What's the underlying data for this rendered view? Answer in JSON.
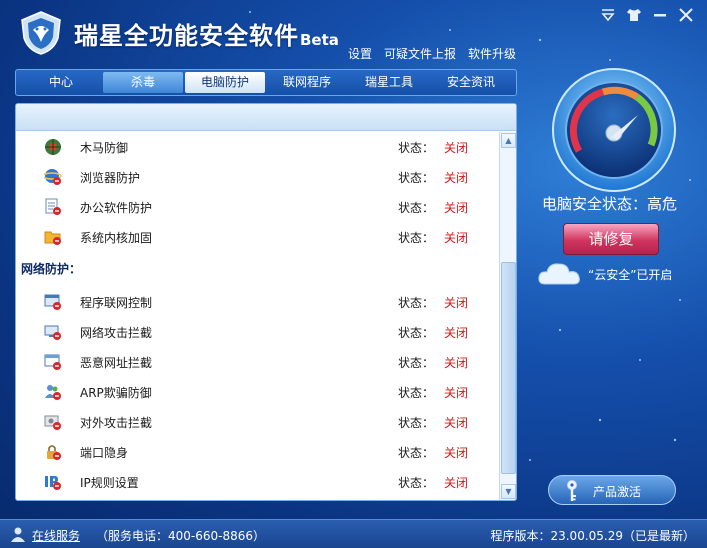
{
  "app": {
    "title": "瑞星全功能安全软件",
    "edition": "Beta"
  },
  "top_links": {
    "settings": "设置",
    "report": "可疑文件上报",
    "upgrade": "软件升级"
  },
  "tabs": [
    {
      "label": "中心"
    },
    {
      "label": "杀毒"
    },
    {
      "label": "电脑防护"
    },
    {
      "label": "联网程序"
    },
    {
      "label": "瑞星工具"
    },
    {
      "label": "安全资讯"
    }
  ],
  "active_tab": "电脑防护",
  "list": {
    "status_label": "状态：",
    "section_network": "网络防护：",
    "items_top": [
      {
        "name": "木马防御",
        "status": "关闭",
        "icon": "trojan-defense-icon"
      },
      {
        "name": "浏览器防护",
        "status": "关闭",
        "icon": "browser-protection-icon"
      },
      {
        "name": "办公软件防护",
        "status": "关闭",
        "icon": "office-protection-icon"
      },
      {
        "name": "系统内核加固",
        "status": "关闭",
        "icon": "kernel-hardening-icon"
      }
    ],
    "items_network": [
      {
        "name": "程序联网控制",
        "status": "关闭",
        "icon": "network-control-icon"
      },
      {
        "name": "网络攻击拦截",
        "status": "关闭",
        "icon": "attack-intercept-icon"
      },
      {
        "name": "恶意网址拦截",
        "status": "关闭",
        "icon": "malicious-url-icon"
      },
      {
        "name": "ARP欺骗防御",
        "status": "关闭",
        "icon": "arp-defense-icon"
      },
      {
        "name": "对外攻击拦截",
        "status": "关闭",
        "icon": "outbound-attack-icon"
      },
      {
        "name": "端口隐身",
        "status": "关闭",
        "icon": "port-stealth-icon"
      },
      {
        "name": "IP规则设置",
        "status": "关闭",
        "icon": "ip-rules-icon"
      }
    ]
  },
  "security": {
    "status_prefix": "电脑安全状态：",
    "level": "高危",
    "repair_button": "请修复",
    "cloud_text": "“云安全”已开启"
  },
  "activate_button": "产品激活",
  "statusbar": {
    "online_service": "在线服务",
    "hotline": "（服务电话：400-660-8866）",
    "version": "程序版本：23.00.05.29（已是最新）"
  },
  "colors": {
    "accent": "#1550ad",
    "status_off": "#d11a1a",
    "repair": "#d0355f"
  }
}
